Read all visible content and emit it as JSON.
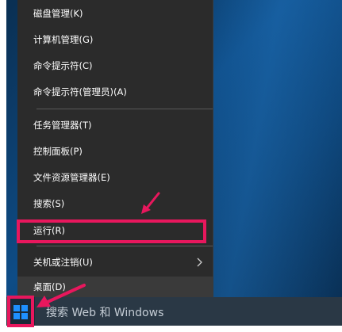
{
  "menu": {
    "items": [
      {
        "label": "磁盘管理(K)"
      },
      {
        "label": "计算机管理(G)"
      },
      {
        "label": "命令提示符(C)"
      },
      {
        "label": "命令提示符(管理员)(A)"
      },
      {
        "label": "任务管理器(T)"
      },
      {
        "label": "控制面板(P)"
      },
      {
        "label": "文件资源管理器(E)"
      },
      {
        "label": "搜索(S)"
      },
      {
        "label": "运行(R)"
      },
      {
        "label": "关机或注销(U)"
      },
      {
        "label": "桌面(D)"
      }
    ]
  },
  "taskbar": {
    "search_placeholder": "搜索 Web 和 Windows"
  },
  "colors": {
    "highlight": "#e8175d",
    "menu_bg": "#2b2b2b",
    "taskbar_bg": "#101a24",
    "start_icon": "#1e90ff"
  },
  "icons": {
    "start": "windows-logo-icon",
    "submenu": "chevron-right-icon",
    "annotation": "pointer-arrow-icon"
  }
}
